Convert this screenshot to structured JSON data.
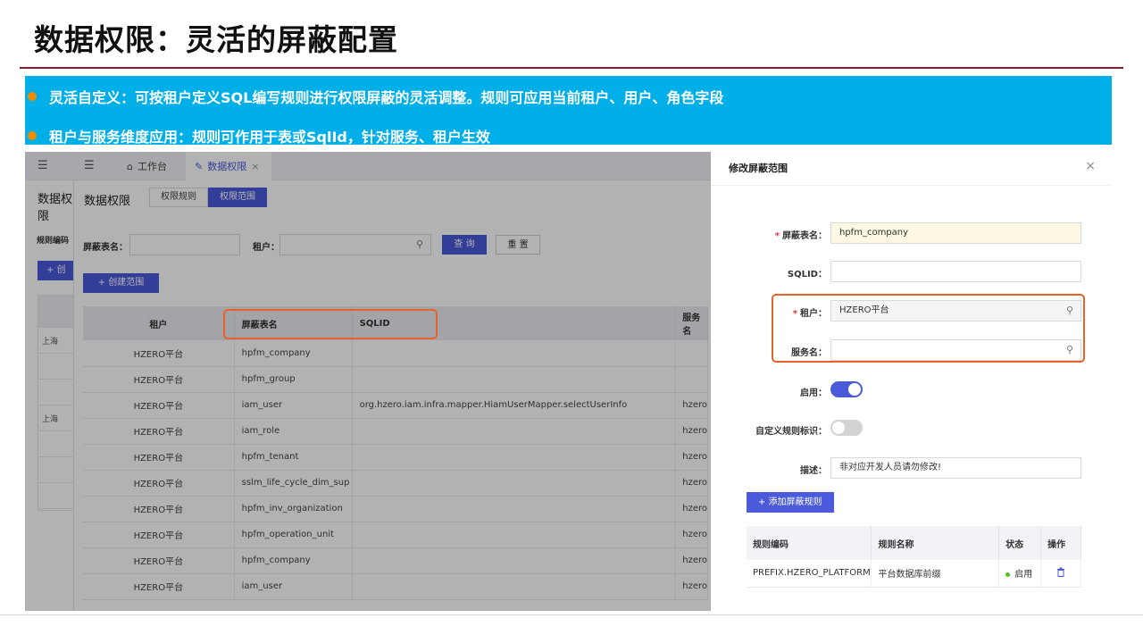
{
  "slide": {
    "title": "数据权限：灵活的屏蔽配置",
    "bullets": [
      "灵活自定义：可按租户定义SQL编写规则进行权限屏蔽的灵活调整。规则可应用当前租户、用户、角色字段",
      "租户与服务维度应用：规则可作用于表或SqlId，针对服务、租户生效"
    ]
  },
  "app": {
    "tabs": {
      "workbench": "工作台",
      "data_perm": "数据权限",
      "close": "×"
    },
    "left": {
      "title": "数据权限",
      "rule_code_label": "规则编码",
      "create_btn": "+ 创",
      "rows": [
        "",
        "上海",
        "",
        "",
        "上海",
        "",
        "",
        "",
        ""
      ]
    },
    "main": {
      "title": "数据权限",
      "tab_rules": "权限规则",
      "tab_scope": "权限范围",
      "filter_table_label": "屏蔽表名：",
      "filter_tenant_label": "租户：",
      "query_btn": "查 询",
      "reset_btn": "重 置",
      "create_btn": "+ 创建范围",
      "columns": [
        "租户",
        "屏蔽表名",
        "SQLID",
        "服务名"
      ],
      "rows": [
        [
          "HZERO平台",
          "hpfm_company",
          "",
          ""
        ],
        [
          "HZERO平台",
          "hpfm_group",
          "",
          ""
        ],
        [
          "HZERO平台",
          "iam_user",
          "org.hzero.iam.infra.mapper.HiamUserMapper.selectUserInfo",
          "hzero"
        ],
        [
          "HZERO平台",
          "iam_role",
          "",
          "hzero"
        ],
        [
          "HZERO平台",
          "hpfm_tenant",
          "",
          "hzero"
        ],
        [
          "HZERO平台",
          "sslm_life_cycle_dim_sup",
          "",
          "hzero"
        ],
        [
          "HZERO平台",
          "hpfm_inv_organization",
          "",
          "hzero"
        ],
        [
          "HZERO平台",
          "hpfm_operation_unit",
          "",
          "hzero"
        ],
        [
          "HZERO平台",
          "hpfm_company",
          "",
          "hzero"
        ],
        [
          "HZERO平台",
          "iam_user",
          "",
          "hzero"
        ]
      ]
    }
  },
  "modal": {
    "title": "修改屏蔽范围",
    "close": "×",
    "fields": {
      "table_label": "屏蔽表名：",
      "table_value": "hpfm_company",
      "sqlid_label": "SQLID：",
      "sqlid_value": "",
      "tenant_label": "租户：",
      "tenant_value": "HZERO平台",
      "service_label": "服务名：",
      "service_value": "",
      "enabled_label": "启用：",
      "custom_label": "自定义规则标识：",
      "desc_label": "描述：",
      "desc_value": "非对应开发人员请勿修改!"
    },
    "enabled": true,
    "custom_rule": false,
    "add_btn": "+ 添加屏蔽规则",
    "rule_columns": [
      "规则编码",
      "规则名称",
      "状态",
      "操作"
    ],
    "rule_rows": [
      {
        "code": "PREFIX.HZERO_PLATFORM",
        "name": "平台数据库前缀",
        "status": "启用"
      }
    ]
  },
  "colors": {
    "accent": "#4a5adb",
    "banner": "#00aee8",
    "highlight": "#e8632b",
    "title_rule": "#8b1a2b"
  }
}
